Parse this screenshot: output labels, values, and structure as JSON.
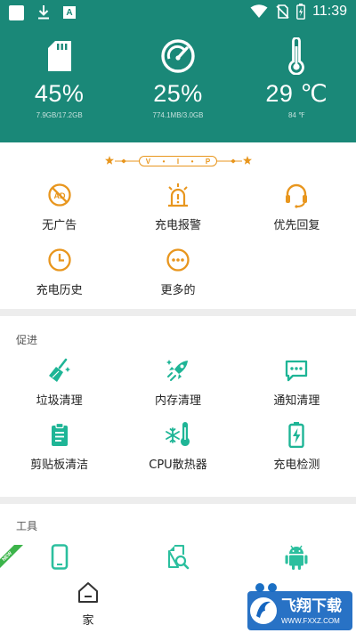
{
  "status_bar": {
    "time": "11:39",
    "notification_letter": "A"
  },
  "header": {
    "stats": [
      {
        "icon": "sd-card-icon",
        "value": "45%",
        "detail": "7.9GB/17.2GB"
      },
      {
        "icon": "speedometer-icon",
        "value": "25%",
        "detail": "774.1MB/3.0GB"
      },
      {
        "icon": "thermometer-icon",
        "value": "29 ℃",
        "detail": "84 ℉"
      }
    ]
  },
  "vip": {
    "banner_letters": [
      "V",
      "I",
      "P"
    ],
    "items": [
      {
        "icon": "no-ads-icon",
        "label": "无广告"
      },
      {
        "icon": "charge-alarm-icon",
        "label": "充电报警"
      },
      {
        "icon": "headset-icon",
        "label": "优先回复"
      },
      {
        "icon": "clock-icon",
        "label": "充电历史"
      },
      {
        "icon": "more-icon",
        "label": "更多的"
      }
    ]
  },
  "promo": {
    "title": "促进",
    "items": [
      {
        "icon": "broom-icon",
        "label": "垃圾清理"
      },
      {
        "icon": "rocket-icon",
        "label": "内存清理"
      },
      {
        "icon": "chat-icon",
        "label": "通知清理"
      },
      {
        "icon": "clipboard-icon",
        "label": "剪贴板清洁"
      },
      {
        "icon": "cpu-cooler-icon",
        "label": "CPU散热器"
      },
      {
        "icon": "battery-check-icon",
        "label": "充电检测"
      }
    ]
  },
  "tools": {
    "title": "工具",
    "new_badge": "NEW",
    "items": [
      {
        "icon": "phone-icon"
      },
      {
        "icon": "file-search-icon"
      },
      {
        "icon": "android-icon"
      }
    ]
  },
  "bottom_nav": {
    "home_label": "家"
  },
  "watermark": {
    "text": "飞翔下载",
    "url": "WWW.FXXZ.COM"
  },
  "colors": {
    "header": "#1a8878",
    "vip_accent": "#e8961e",
    "promo_accent": "#1eb596",
    "tool_accent": "#2bbf9e"
  }
}
